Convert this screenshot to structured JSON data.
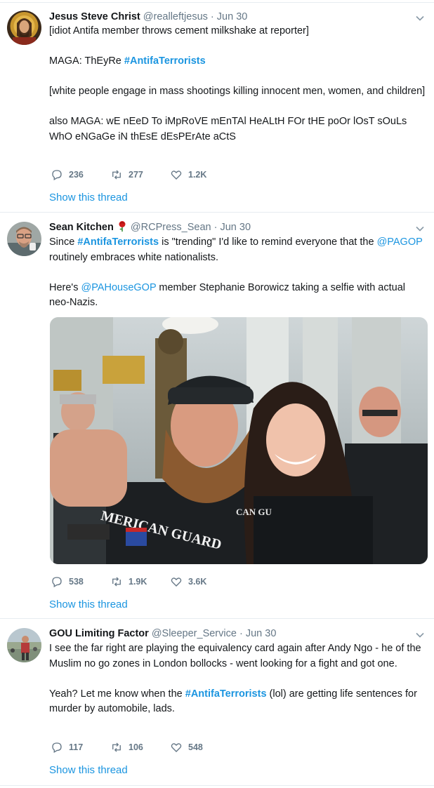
{
  "tweets": [
    {
      "author_name": "Jesus Steve Christ",
      "handle": "@realleftjesus",
      "date": "Jun 30",
      "lines": {
        "l1": "[idiot Antifa member throws cement milkshake at reporter]",
        "l2_pre": "MAGA: ThEyRe ",
        "l2_tag": "#AntifaTerrorists",
        "l3": "[white people engage in mass shootings killing innocent men, women, and children]",
        "l4": "also MAGA: wE nEeD To iMpRoVE mEnTAl HeALtH FOr tHE poOr lOsT sOuLs WhO eNGaGe iN thEsE dEsPErAte aCtS"
      },
      "replies": "236",
      "retweets": "277",
      "likes": "1.2K",
      "thread_link": "Show this thread"
    },
    {
      "author_name": "Sean Kitchen",
      "name_emoji": "rose-icon",
      "handle": "@RCPress_Sean",
      "date": "Jun 30",
      "lines": {
        "p1_a": "Since ",
        "p1_tag": "#AntifaTerrorists",
        "p1_b": " is \"trending\" I'd like to remind everyone that the ",
        "p1_mention": "@PAGOP",
        "p1_c": " routinely embraces white nationalists.",
        "p2_a": "Here's ",
        "p2_mention": "@PAHouseGOP",
        "p2_b": " member Stephanie Borowicz taking a selfie with actual neo-Nazis."
      },
      "photo_shirt_text": "MERICAN GUARD",
      "photo_shirt_text_2": "CAN GU",
      "replies": "538",
      "retweets": "1.9K",
      "likes": "3.6K",
      "thread_link": "Show this thread"
    },
    {
      "author_name": "GOU Limiting Factor",
      "handle": "@Sleeper_Service",
      "date": "Jun 30",
      "lines": {
        "p1": "I see the far right are playing the equivalency card again after Andy Ngo - he of the Muslim no go zones in London bollocks - went looking for a fight and got one.",
        "p2_a": "Yeah? Let me know when the ",
        "p2_tag": "#AntifaTerrorists",
        "p2_b": " (lol) are getting life sentences for murder by automobile, lads."
      },
      "replies": "117",
      "retweets": "106",
      "likes": "548",
      "thread_link": "Show this thread"
    }
  ],
  "separator": "·",
  "colors": {
    "link": "#1b95e0",
    "muted": "#657786",
    "text": "#14171a",
    "divider": "#e6ecf0"
  }
}
